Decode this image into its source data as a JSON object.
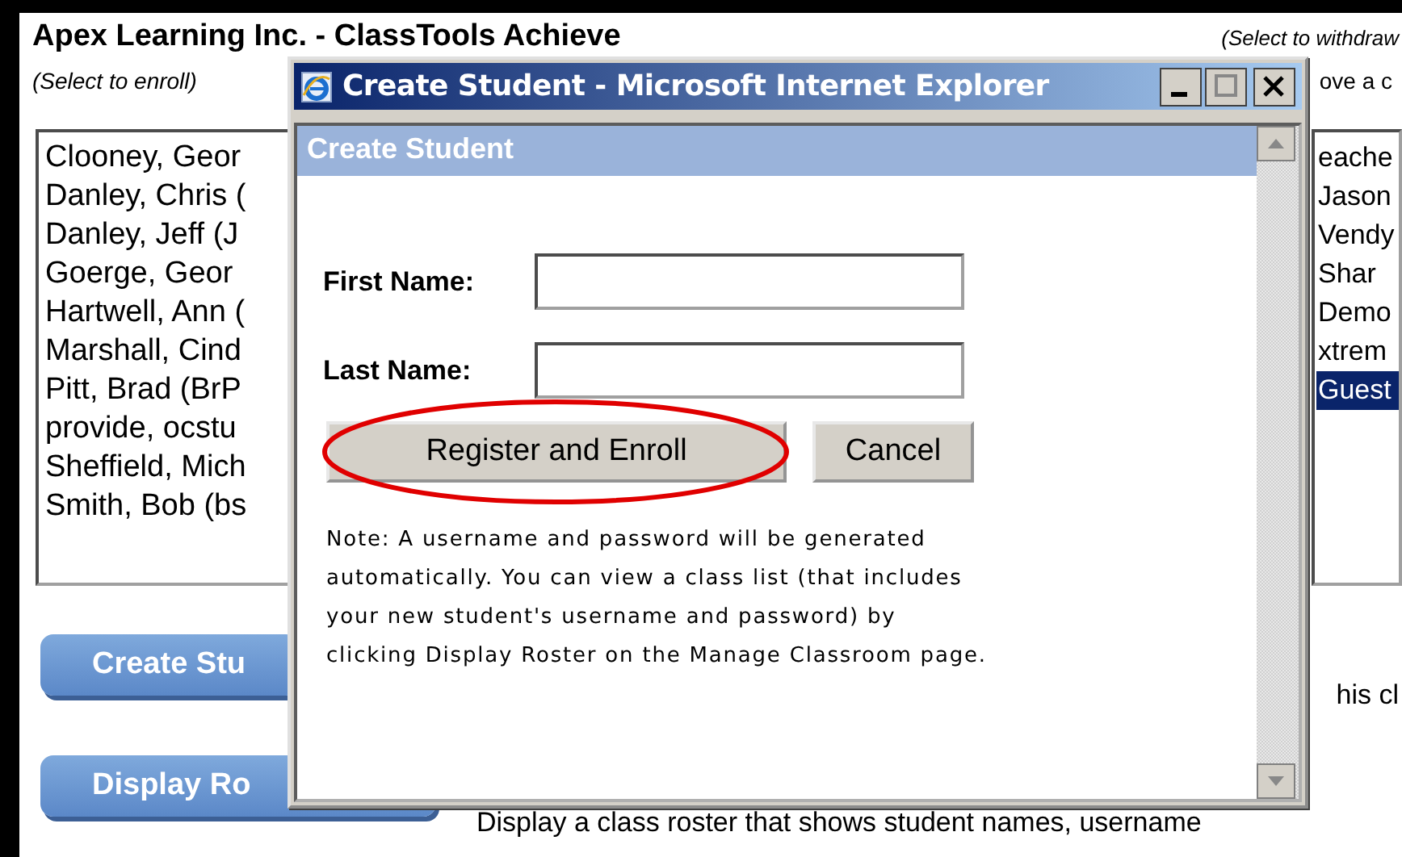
{
  "app": {
    "title": "Apex Learning Inc. - ClassTools Achieve",
    "enroll_hint": "(Select to enroll)",
    "withdraw_hint": "(Select to withdraw",
    "right_hint": "ove a c"
  },
  "available_students": [
    {
      "name": "Clooney, Geor",
      "selected": false
    },
    {
      "name": "Danley, Chris (",
      "selected": false
    },
    {
      "name": "Danley, Jeff (J",
      "selected": false
    },
    {
      "name": "Goerge, Geor",
      "selected": false
    },
    {
      "name": "Hartwell, Ann (",
      "selected": false
    },
    {
      "name": "Marshall, Cind",
      "selected": false
    },
    {
      "name": "Pitt, Brad (BrP",
      "selected": false
    },
    {
      "name": "provide, ocstu",
      "selected": false
    },
    {
      "name": "Sheffield, Mich",
      "selected": false
    },
    {
      "name": "Smith, Bob (bs",
      "selected": false
    }
  ],
  "enrolled_students": [
    {
      "name": "eache",
      "selected": false
    },
    {
      "name": "Jason",
      "selected": false
    },
    {
      "name": "Vendy",
      "selected": false
    },
    {
      "name": "Shar",
      "selected": false
    },
    {
      "name": "Demo",
      "selected": false
    },
    {
      "name": "xtrem",
      "selected": false
    },
    {
      "name": "Guest",
      "selected": true
    }
  ],
  "actions": [
    {
      "label": "Create Stu",
      "description": "his cl"
    },
    {
      "label": "Display Ro",
      "description": "Display a class roster that shows student names, username"
    }
  ],
  "dialog": {
    "title": "Create Student - Microsoft Internet Explorer",
    "heading": "Create Student",
    "fields": [
      {
        "label": "First Name:"
      },
      {
        "label": "Last Name:"
      }
    ],
    "buttons": [
      {
        "label": "Register and Enroll",
        "highlighted": true
      },
      {
        "label": "Cancel",
        "highlighted": false
      }
    ],
    "note": "Note: A username and password will be generated automatically. You can view a class list (that includes your new student's username and password) by clicking Display Roster on the Manage Classroom page."
  }
}
